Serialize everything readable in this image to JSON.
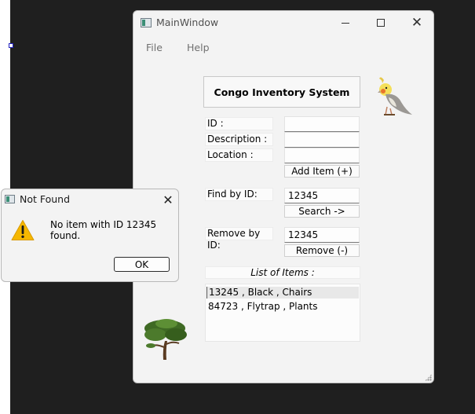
{
  "main_window": {
    "title": "MainWindow",
    "controls": {
      "minimize": "minimize-icon",
      "maximize": "maximize-icon",
      "close": "✕"
    },
    "menu": [
      "File",
      "Help"
    ],
    "header_button": "Congo Inventory System",
    "fields": {
      "id_label": "ID :",
      "description_label": "Description :",
      "location_label": "Location :",
      "id_value": "",
      "description_value": "",
      "location_value": "",
      "add_button": "Add Item (+)"
    },
    "find": {
      "label": "Find by ID:",
      "value": "12345",
      "button": "Search ->"
    },
    "remove": {
      "label": "Remove by ID:",
      "value": "12345",
      "button": "Remove (-)"
    },
    "list": {
      "header": "List of Items :",
      "items": [
        "13245 , Black , Chairs",
        "84723 , Flytrap , Plants"
      ],
      "selected_index": 0
    }
  },
  "dialog": {
    "title": "Not Found",
    "close": "✕",
    "message": "No item with ID 12345 found.",
    "ok_button": "OK",
    "icon": "warning-icon"
  },
  "colors": {
    "background": "#1f1f1f",
    "window": "#f3f3f3",
    "warning": "#f5b700"
  }
}
